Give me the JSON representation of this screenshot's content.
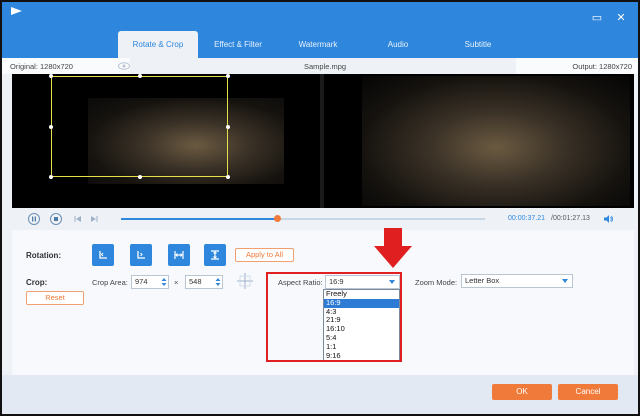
{
  "tabs": [
    {
      "label": "Rotate & Crop",
      "active": true
    },
    {
      "label": "Effect & Filter",
      "active": false
    },
    {
      "label": "Watermark",
      "active": false
    },
    {
      "label": "Audio",
      "active": false
    },
    {
      "label": "Subtitle",
      "active": false
    }
  ],
  "preview": {
    "original_label": "Original: 1280x720",
    "file_name": "Sample.mpg",
    "output_label": "Output: 1280x720"
  },
  "playback": {
    "current_time": "00:00:37.21",
    "total_time": "/00:01:27.13",
    "progress": 0.43
  },
  "rotation": {
    "label": "Rotation:",
    "apply_all_label": "Apply to All",
    "buttons": [
      "rotate-left",
      "rotate-right",
      "flip-horizontal",
      "flip-vertical"
    ]
  },
  "crop": {
    "label": "Crop:",
    "reset_label": "Reset",
    "area_label": "Crop Area:",
    "width": "974",
    "times": "×",
    "height": "548"
  },
  "aspect_ratio": {
    "label": "Aspect Ratio:",
    "value": "16:9",
    "options": [
      "Freely",
      "16:9",
      "4:3",
      "21:9",
      "16:10",
      "5:4",
      "1:1",
      "9:16"
    ],
    "selected_index": 1
  },
  "zoom_mode": {
    "label": "Zoom Mode:",
    "value": "Letter Box"
  },
  "footer": {
    "ok_label": "OK",
    "cancel_label": "Cancel"
  },
  "colors": {
    "accent": "#2e86dd",
    "orange": "#f07a3a",
    "highlight_red": "#e02020"
  }
}
